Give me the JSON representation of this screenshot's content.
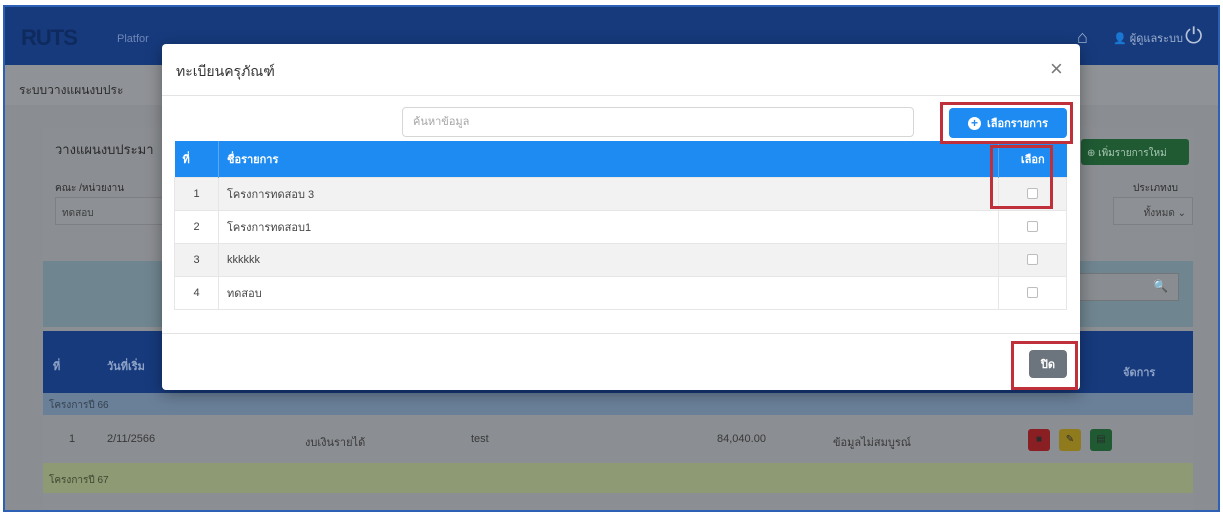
{
  "app": {
    "logo_text": "RUTS",
    "brand_sub": "Platfor",
    "user_name": "ผู้ดูแลระบบ"
  },
  "page": {
    "header_title": "ระบบวางแผนงบประ",
    "card_title": "วางแผนงบประมา",
    "add_button_label": "เพิ่มรายการใหม่",
    "dept_label": "คณะ /หน่วยงาน",
    "dept_value": "ทดสอบ",
    "right_label": "ประเภทงบ",
    "right_value": "ทั้งหมด"
  },
  "bg_table": {
    "headers": {
      "no": "ที่",
      "date": "วันที่เริ่ม",
      "manage": "จัดการ"
    },
    "group1": "โครงการปี 66",
    "row": {
      "no": "1",
      "date": "2/11/2566",
      "type": "งบเงินรายได้",
      "name": "test",
      "amount": "84,040.00",
      "status": "ข้อมูลไม่สมบูรณ์"
    },
    "group2": "โครงการปี 67"
  },
  "modal": {
    "title": "ทะเบียนครุภัณฑ์",
    "search_placeholder": "ค้นหาข้อมูล",
    "select_button_label": "เลือกรายการ",
    "close_button_label": "ปิด",
    "columns": {
      "no": "ที่",
      "name": "ชื่อรายการ",
      "pick": "เลือก"
    },
    "rows": [
      {
        "no": "1",
        "name": "โครงการทดสอบ 3"
      },
      {
        "no": "2",
        "name": "โครงการทดสอบ1"
      },
      {
        "no": "3",
        "name": "kkkkkk"
      },
      {
        "no": "4",
        "name": "ทดสอบ"
      }
    ]
  },
  "colors": {
    "primary": "#1d8bf1",
    "navbar": "#163a7c",
    "highlight": "#c0303b",
    "close_button": "#6c757d"
  },
  "icons": [
    "home-icon",
    "user-icon",
    "power-icon",
    "close-icon",
    "plus-circle-icon",
    "search-icon",
    "trash-icon",
    "edit-icon",
    "file-icon"
  ]
}
